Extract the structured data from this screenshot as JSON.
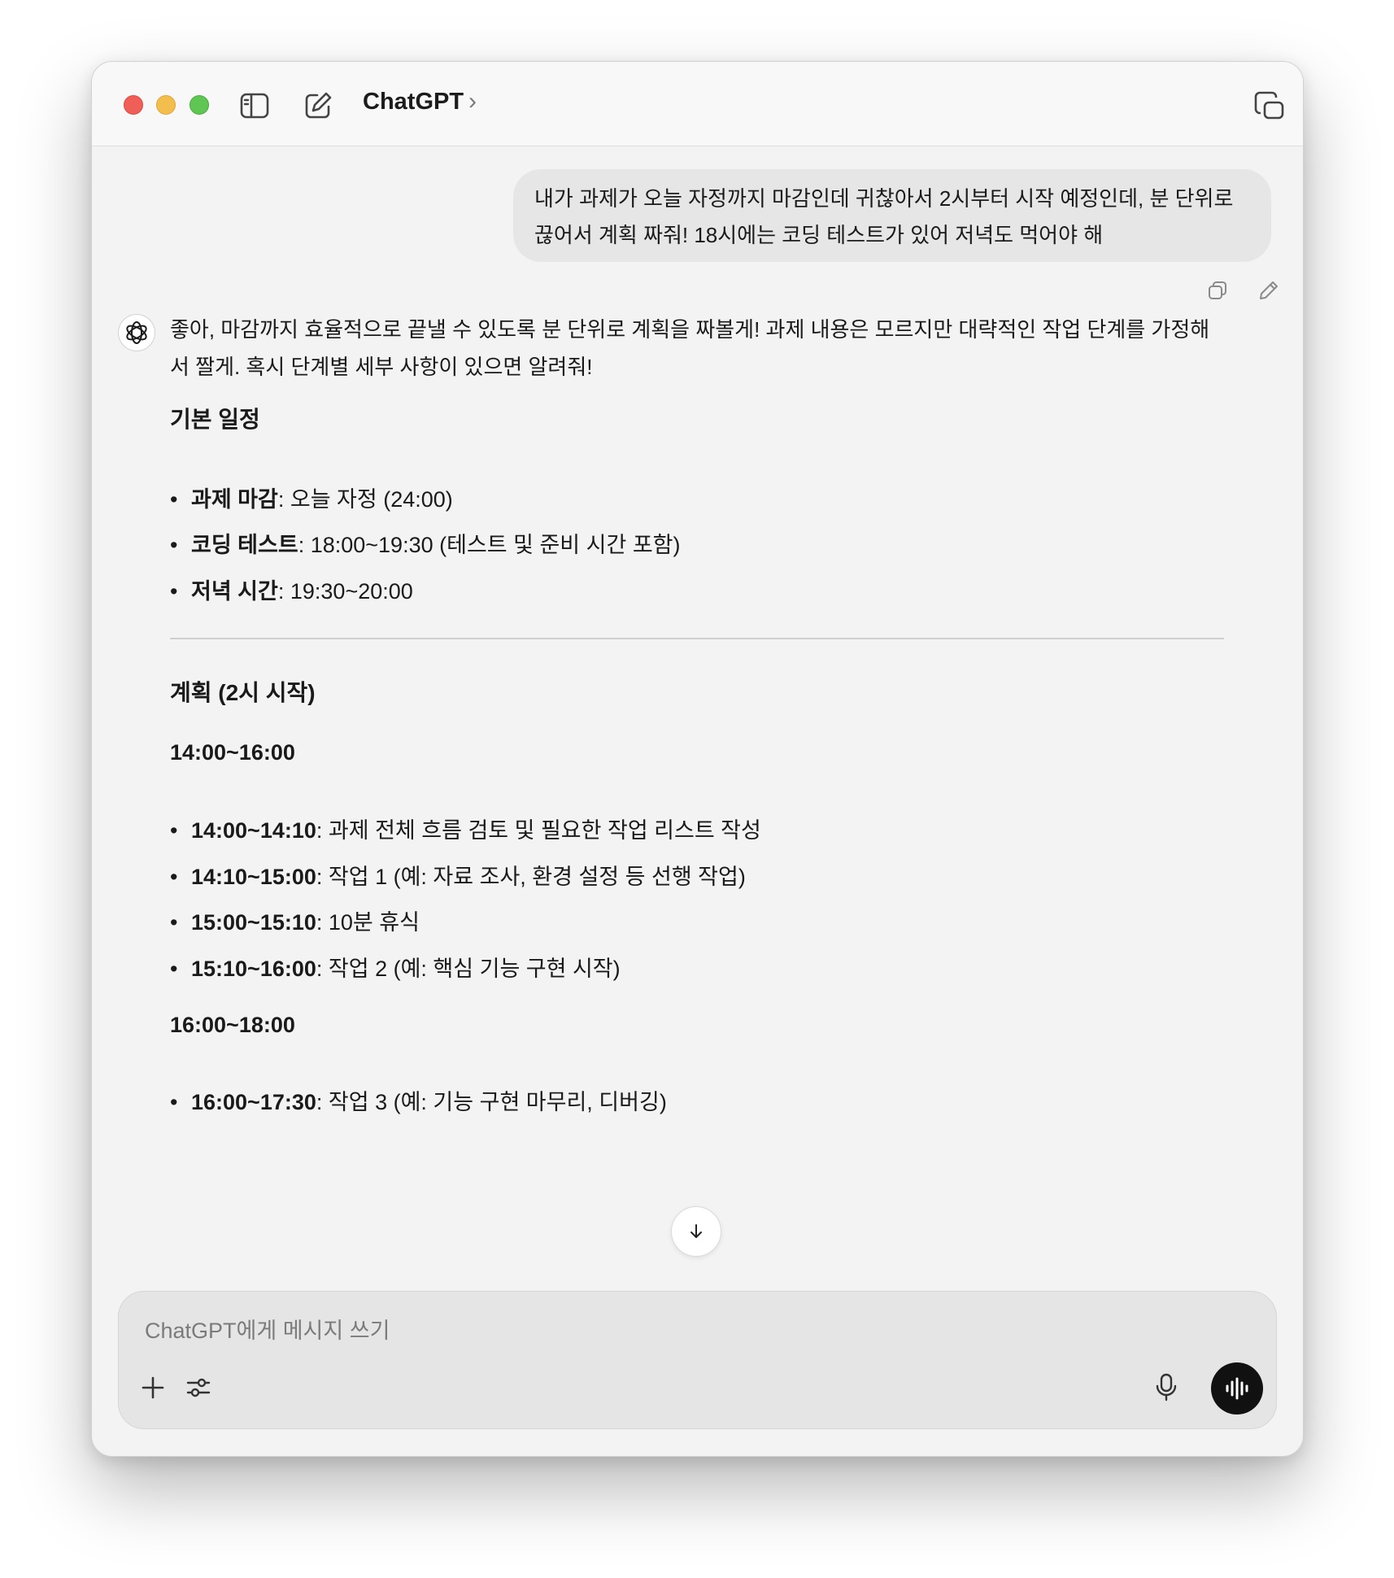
{
  "titlebar": {
    "app_title": "ChatGPT",
    "chevron": "›",
    "icons": [
      "sidebar-toggle-icon",
      "new-chat-icon",
      "new-window-icon"
    ]
  },
  "user_message": {
    "line1": "내가 과제가 오늘 자정까지 마감인데 귀찮아서 2시부터 시작 예정인데, 분 단위로",
    "line2": "끊어서 계획 짜줘! 18시에는 코딩 테스트가 있어 저녁도 먹어야 해"
  },
  "assistant": {
    "intro": "좋아, 마감까지 효율적으로 끝낼 수 있도록 분 단위로 계획을 짜볼게! 과제 내용은 모르지만 대략적인 작업 단계를 가정해서 짤게. 혹시 단계별 세부 사항이 있으면 알려줘!",
    "section1_title": "기본 일정",
    "schedule": [
      {
        "label": "과제 마감",
        "text": ": 오늘 자정 (24:00)"
      },
      {
        "label": "코딩 테스트",
        "text": ": 18:00~19:30 (테스트 및 준비 시간 포함)"
      },
      {
        "label": "저녁 시간",
        "text": ": 19:30~20:00"
      }
    ],
    "section2_title": "계획 (2시 시작)",
    "block1_title": "14:00~16:00",
    "block1_items": [
      {
        "label": "14:00~14:10",
        "text": ": 과제 전체 흐름 검토 및 필요한 작업 리스트 작성"
      },
      {
        "label": "14:10~15:00",
        "text": ": 작업 1 (예: 자료 조사, 환경 설정 등 선행 작업)"
      },
      {
        "label": "15:00~15:10",
        "text": ": 10분 휴식"
      },
      {
        "label": "15:10~16:00",
        "text": ": 작업 2 (예: 핵심 기능 구현 시작)"
      }
    ],
    "block2_title": "16:00~18:00",
    "block2_items": [
      {
        "label": "16:00~17:30",
        "text": ": 작업 3 (예: 기능 구현 마무리, 디버깅)"
      }
    ]
  },
  "composer": {
    "placeholder": "ChatGPT에게 메시지 쓰기"
  },
  "colors": {
    "window_bg": "#f3f3f3",
    "titlebar_bg": "#f8f8f8",
    "user_bubble": "#e6e6e6",
    "composer_bg": "#e5e5e5",
    "voice_button": "#111111",
    "traffic_red": "#ef5f58",
    "traffic_yellow": "#f4be4f",
    "traffic_green": "#5fc553"
  }
}
